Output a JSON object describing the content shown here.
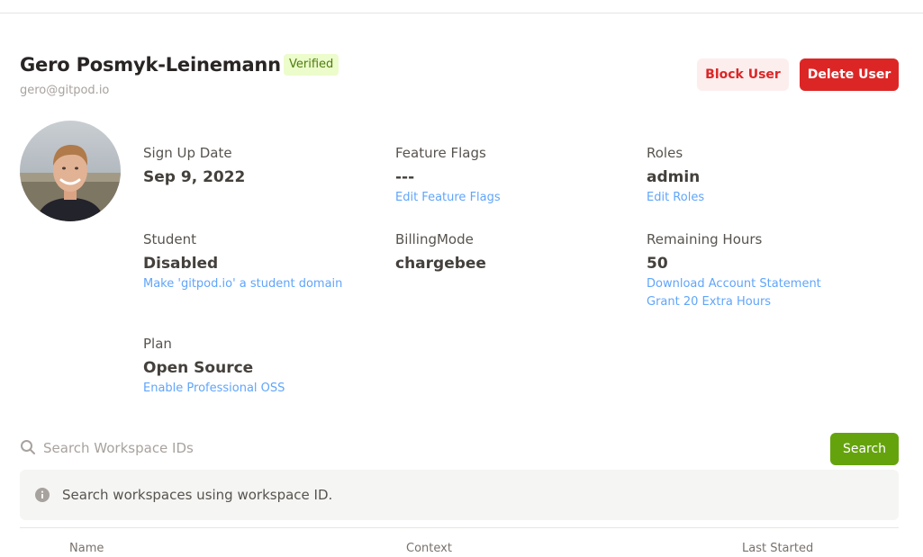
{
  "user": {
    "name": "Gero Posmyk-Leinemann",
    "verified_badge": "Verified",
    "email": "gero@gitpod.io"
  },
  "actions": {
    "block_label": "Block User",
    "delete_label": "Delete User"
  },
  "fields": {
    "signup": {
      "label": "Sign Up Date",
      "value": "Sep 9, 2022"
    },
    "feature_flags": {
      "label": "Feature Flags",
      "value": "---",
      "link": "Edit Feature Flags"
    },
    "roles": {
      "label": "Roles",
      "value": "admin",
      "link": "Edit Roles"
    },
    "student": {
      "label": "Student",
      "value": "Disabled",
      "link": "Make 'gitpod.io' a student domain"
    },
    "billing_mode": {
      "label": "BillingMode",
      "value": "chargebee"
    },
    "remaining_hours": {
      "label": "Remaining Hours",
      "value": "50",
      "link1": "Download Account Statement",
      "link2": "Grant 20 Extra Hours"
    },
    "plan": {
      "label": "Plan",
      "value": "Open Source",
      "link": "Enable Professional OSS"
    }
  },
  "search": {
    "placeholder": "Search Workspace IDs",
    "button_label": "Search",
    "info_text": "Search workspaces using workspace ID."
  },
  "table": {
    "columns": [
      "Name",
      "Context",
      "Last Started"
    ]
  },
  "colors": {
    "danger": "#dc2626",
    "danger_soft": "#fdeeee",
    "success": "#65a30d",
    "link": "#60a5fa",
    "verified_bg": "#ecfccb",
    "verified_text": "#4d7c0f"
  },
  "icons": {
    "search": "search-icon",
    "info": "info-icon",
    "avatar": "user-avatar"
  }
}
